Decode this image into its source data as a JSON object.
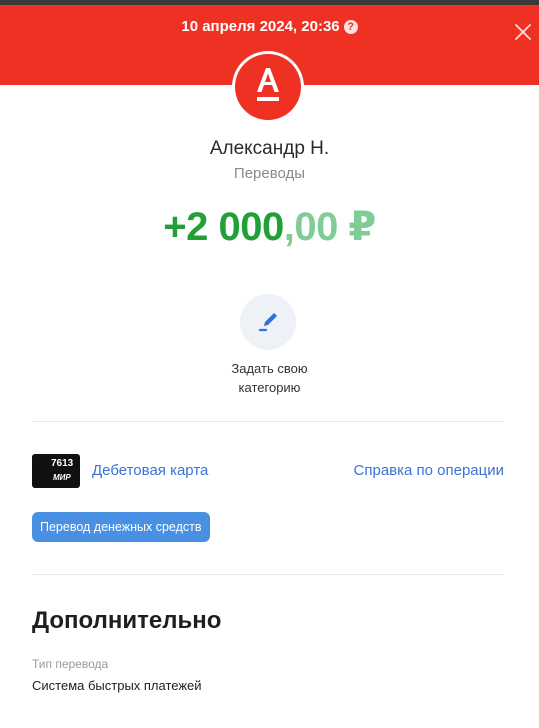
{
  "header": {
    "datetime": "10 апреля 2024, 20:36",
    "help_icon": "question-circle-icon",
    "close_icon": "close-icon",
    "background_color": "#ef3124"
  },
  "logo": {
    "icon": "alfa-bank-logo",
    "letter": "А"
  },
  "counterparty": {
    "name": "Александр Н.",
    "type": "Переводы"
  },
  "amount": {
    "integer": "+2 000",
    "fraction": ",00 ₽",
    "color": "#21a038"
  },
  "category": {
    "icon": "pencil-icon",
    "label_line1": "Задать свою",
    "label_line2": "категорию"
  },
  "card": {
    "number_suffix": "7613",
    "payment_system": "МИР",
    "link_label": "Дебетовая карта"
  },
  "help_link": "Справка по операции",
  "tag": {
    "label": "Перевод денежных средств",
    "color": "#4a90e2"
  },
  "details": {
    "title": "Дополнительно",
    "fields": [
      {
        "label": "Тип перевода",
        "value": "Система быстрых платежей"
      }
    ]
  }
}
